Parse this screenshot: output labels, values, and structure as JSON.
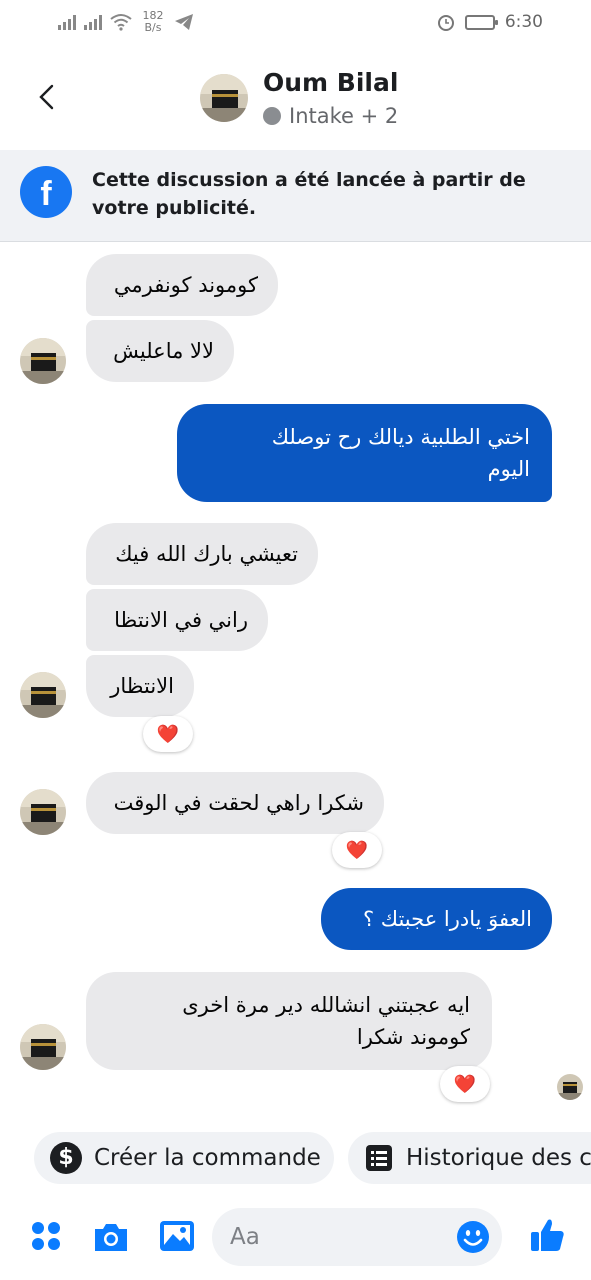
{
  "status_bar": {
    "net_speed": "182",
    "net_unit": "B/s",
    "time": "6:30"
  },
  "header": {
    "name": "Oum Bilal",
    "status": "Intake + 2"
  },
  "banner": {
    "text": "Cette discussion a été lancée à partir de votre publicité."
  },
  "messages": [
    {
      "dir": "in",
      "text": "كوموند كونفرمي"
    },
    {
      "dir": "in",
      "text": "لالا ماعليش"
    },
    {
      "dir": "out",
      "lines": [
        "اختي الطلبية ديالك رح توصلك",
        "اليوم"
      ]
    },
    {
      "dir": "in",
      "text": "تعيشي بارك الله فيك"
    },
    {
      "dir": "in",
      "text": "راني في الانتظا"
    },
    {
      "dir": "in",
      "text": "الانتظار",
      "reaction": "❤️"
    },
    {
      "dir": "in",
      "text": "شكرا راهي لحقت في الوقت",
      "reaction": "❤️"
    },
    {
      "dir": "out",
      "text": "العفوَ يادرا عجبتك ؟"
    },
    {
      "dir": "in",
      "lines": [
        "ايه عجبتني انشالله دير مرة اخرى",
        "كوموند شكرا"
      ],
      "reaction": "❤️"
    }
  ],
  "quick_actions": [
    {
      "label": "Créer la commande",
      "icon": "dollar-icon"
    },
    {
      "label": "Historique des c",
      "icon": "list-icon"
    }
  ],
  "composer": {
    "placeholder": "Aa"
  },
  "colors": {
    "outgoing": "#0b57c1",
    "incoming": "#e9e9eb",
    "accent": "#1877f2"
  }
}
